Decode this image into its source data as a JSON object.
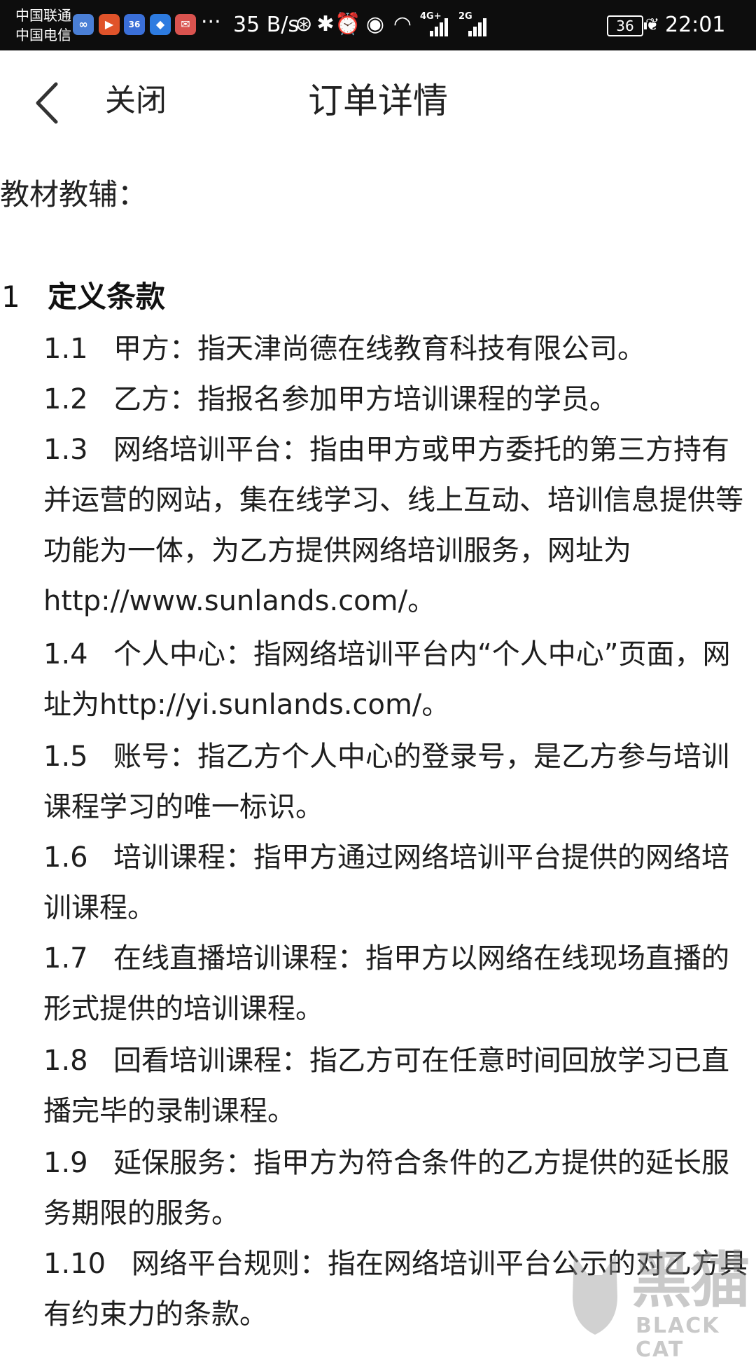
{
  "status_bar": {
    "carrier_1": "中国联通",
    "carrier_2": "中国电信",
    "more": "···",
    "speed": "35 B/s",
    "network_4g": "4G+",
    "network_2g": "2G",
    "battery": "36",
    "time": "22:01"
  },
  "header": {
    "back_icon": "chevron-left-icon",
    "close_label": "关闭",
    "title": "订单详情"
  },
  "content": {
    "section_label": "教材教辅：",
    "clause_number": "1",
    "clause_title": "定义条款",
    "clauses": [
      {
        "num": "1.1",
        "text": "甲方：指天津尚德在线教育科技有限公司。"
      },
      {
        "num": "1.2",
        "text": "乙方：指报名参加甲方培训课程的学员。"
      },
      {
        "num": "1.3",
        "text": "网络培训平台：指由甲方或甲方委托的第三方持有并运营的网站，集在线学习、线上互动、培训信息提供等功能为一体，为乙方提供网络培训服务，网址为http://www.sunlands.com/。"
      },
      {
        "num": "1.4",
        "text": "个人中心：指网络培训平台内“个人中心”页面，网址为http://yi.sunlands.com/。"
      },
      {
        "num": "1.5",
        "text": "账号：指乙方个人中心的登录号，是乙方参与培训课程学习的唯一标识。"
      },
      {
        "num": "1.6",
        "text": "培训课程：指甲方通过网络培训平台提供的网络培训课程。"
      },
      {
        "num": "1.7",
        "text": "在线直播培训课程：指甲方以网络在线现场直播的形式提供的培训课程。"
      },
      {
        "num": "1.8",
        "text": "回看培训课程：指乙方可在任意时间回放学习已直播完毕的录制课程。"
      },
      {
        "num": "1.9",
        "text": "延保服务：指甲方为符合条件的乙方提供的延长服务期限的服务。"
      },
      {
        "num": "1.10",
        "text": "网络平台规则：指在网络培训平台公示的对乙方具有约束力的条款。"
      }
    ]
  },
  "watermark": {
    "cn": "黑猫",
    "en": "BLACK CAT"
  }
}
